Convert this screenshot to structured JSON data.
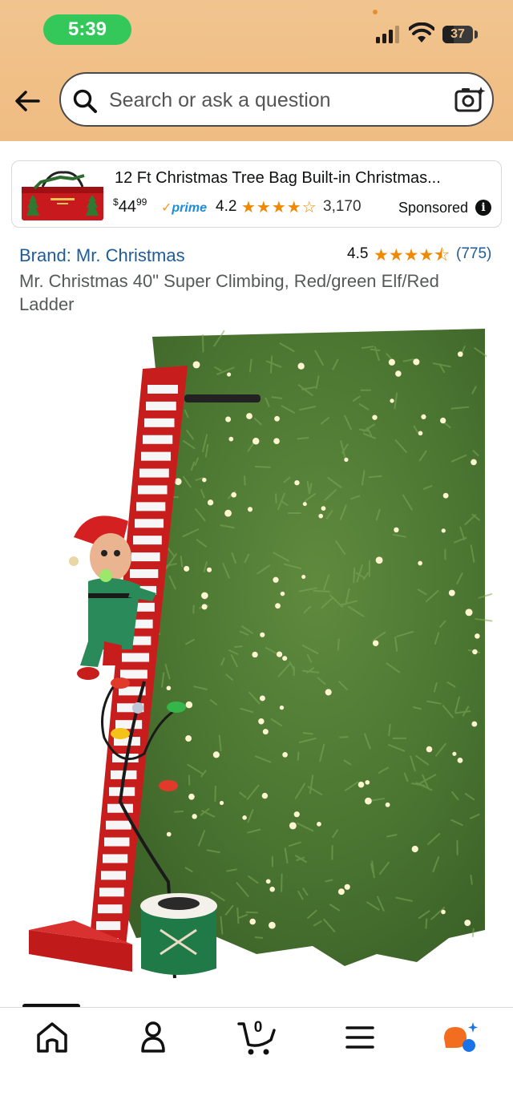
{
  "status_bar": {
    "time": "5:39",
    "battery": "37",
    "battery_level": 0.37
  },
  "search": {
    "placeholder": "Search or ask a question"
  },
  "sponsored_ad": {
    "title": "12 Ft Christmas Tree Bag Built-in Christmas...",
    "price_currency": "$",
    "price_dollars": "44",
    "price_cents": "99",
    "prime_label": "prime",
    "rating": "4.2",
    "stars": "★★★★☆",
    "review_count": "3,170",
    "label": "Sponsored",
    "info_icon": "i"
  },
  "product": {
    "brand": "Brand: Mr. Christmas",
    "rating": "4.5",
    "stars": "★★★★⯪",
    "review_count": "(775)",
    "title": "Mr. Christmas 40\" Super Climbing, Red/green Elf/Red Ladder"
  },
  "bottom_nav": {
    "items": [
      "home-icon",
      "account-icon",
      "cart-icon",
      "menu-icon",
      "rufus-icon"
    ],
    "cart_count": "0"
  },
  "colors": {
    "header_bg": "#f0bf86",
    "link": "#1f5b96",
    "star": "#f08804",
    "prime_blue": "#1a8cd8"
  }
}
